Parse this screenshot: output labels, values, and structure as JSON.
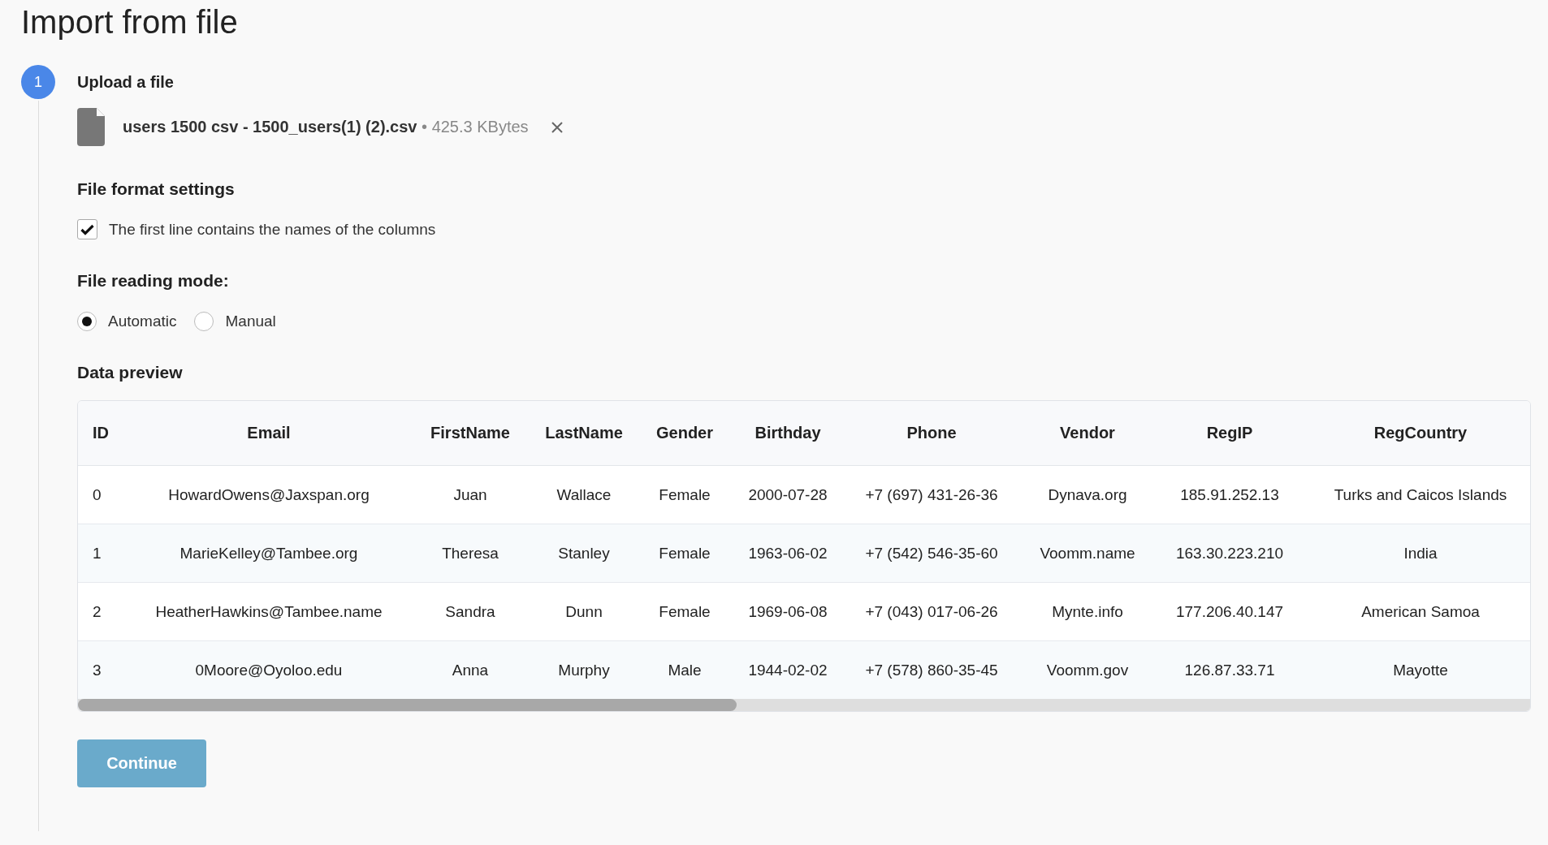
{
  "title": "Import from file",
  "step": {
    "number": "1",
    "title": "Upload a file"
  },
  "file": {
    "name": "users 1500 csv - 1500_users(1) (2).csv",
    "separator": "•",
    "size": "425.3 KBytes"
  },
  "format_settings": {
    "heading": "File format settings",
    "checkbox": {
      "label": "The first line contains the names of the columns",
      "checked": true
    }
  },
  "reading_mode": {
    "heading": "File reading mode:",
    "options": [
      {
        "label": "Automatic",
        "selected": true
      },
      {
        "label": "Manual",
        "selected": false
      }
    ]
  },
  "preview": {
    "heading": "Data preview",
    "columns": [
      "ID",
      "Email",
      "FirstName",
      "LastName",
      "Gender",
      "Birthday",
      "Phone",
      "Vendor",
      "RegIP",
      "RegCountry"
    ],
    "rows": [
      [
        "0",
        "HowardOwens@Jaxspan.org",
        "Juan",
        "Wallace",
        "Female",
        "2000-07-28",
        "+7 (697) 431-26-36",
        "Dynava.org",
        "185.91.252.13",
        "Turks and Caicos Islands"
      ],
      [
        "1",
        "MarieKelley@Tambee.org",
        "Theresa",
        "Stanley",
        "Female",
        "1963-06-02",
        "+7 (542) 546-35-60",
        "Voomm.name",
        "163.30.223.210",
        "India"
      ],
      [
        "2",
        "HeatherHawkins@Tambee.name",
        "Sandra",
        "Dunn",
        "Female",
        "1969-06-08",
        "+7 (043) 017-06-26",
        "Mynte.info",
        "177.206.40.147",
        "American Samoa"
      ],
      [
        "3",
        "0Moore@Oyoloo.edu",
        "Anna",
        "Murphy",
        "Male",
        "1944-02-02",
        "+7 (578) 860-35-45",
        "Voomm.gov",
        "126.87.33.71",
        "Mayotte"
      ]
    ]
  },
  "continue_button": "Continue"
}
